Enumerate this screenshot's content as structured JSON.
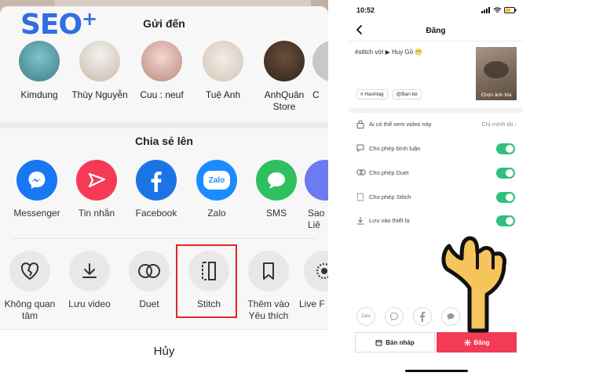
{
  "watermark": {
    "logo": "SEO",
    "plus": "+"
  },
  "send_to": {
    "title": "Gửi đến",
    "contacts": [
      {
        "name": "Kimdung"
      },
      {
        "name": "Thùy Nguyễn"
      },
      {
        "name": "Cuu : neuf"
      },
      {
        "name": "Tuệ Anh"
      },
      {
        "name": "AnhQuân Store"
      },
      {
        "name": "C"
      }
    ]
  },
  "share_to": {
    "title": "Chia sẻ lên",
    "apps": [
      {
        "label": "Messenger",
        "icon": "messenger-icon",
        "color": "#1877f2"
      },
      {
        "label": "Tin nhắn",
        "icon": "send-message-icon",
        "color": "#f43a55"
      },
      {
        "label": "Facebook",
        "icon": "facebook-icon",
        "color": "#1b74e4"
      },
      {
        "label": "Zalo",
        "icon": "zalo-icon",
        "color": "#1a8cff",
        "icon_text": "Zalo"
      },
      {
        "label": "SMS",
        "icon": "sms-icon",
        "color": "#2fbf5f"
      },
      {
        "label": "Sao Liê",
        "icon": "copy-link-icon",
        "color": "#6c7bf0"
      }
    ]
  },
  "actions": [
    {
      "label": "Không quan tâm",
      "icon": "broken-heart-icon"
    },
    {
      "label": "Lưu video",
      "icon": "download-icon"
    },
    {
      "label": "Duet",
      "icon": "duet-icon"
    },
    {
      "label": "Stitch",
      "icon": "stitch-icon"
    },
    {
      "label": "Thêm vào Yêu thích",
      "icon": "bookmark-icon"
    },
    {
      "label": "Live F",
      "icon": "live-icon"
    }
  ],
  "cancel_label": "Hủy",
  "post_screen": {
    "status_time": "10:52",
    "title": "Đăng",
    "caption": "#stitch với ▶ Huy Gỏ 😁",
    "cover_label": "Chọn ảnh bìa",
    "chips": [
      "# Hashtag",
      "@Bạn bè"
    ],
    "privacy": {
      "label": "Ai có thể xem video này",
      "value": "Chỉ mình tôi"
    },
    "settings": [
      {
        "label": "Cho phép bình luận",
        "icon": "comment-icon",
        "enabled": true
      },
      {
        "label": "Cho phép Duet",
        "icon": "duet-small-icon",
        "enabled": true
      },
      {
        "label": "Cho phép Stitch",
        "icon": "stitch-small-icon",
        "enabled": true
      },
      {
        "label": "Lưu vào thiết bị",
        "icon": "save-device-icon",
        "enabled": true
      }
    ],
    "share_icons": [
      "Zalo",
      "messenger",
      "facebook",
      "message"
    ],
    "draft_label": "Bản nháp",
    "post_label": "Đăng",
    "accent_color": "#f33b57",
    "toggle_color": "#2fc07c"
  }
}
